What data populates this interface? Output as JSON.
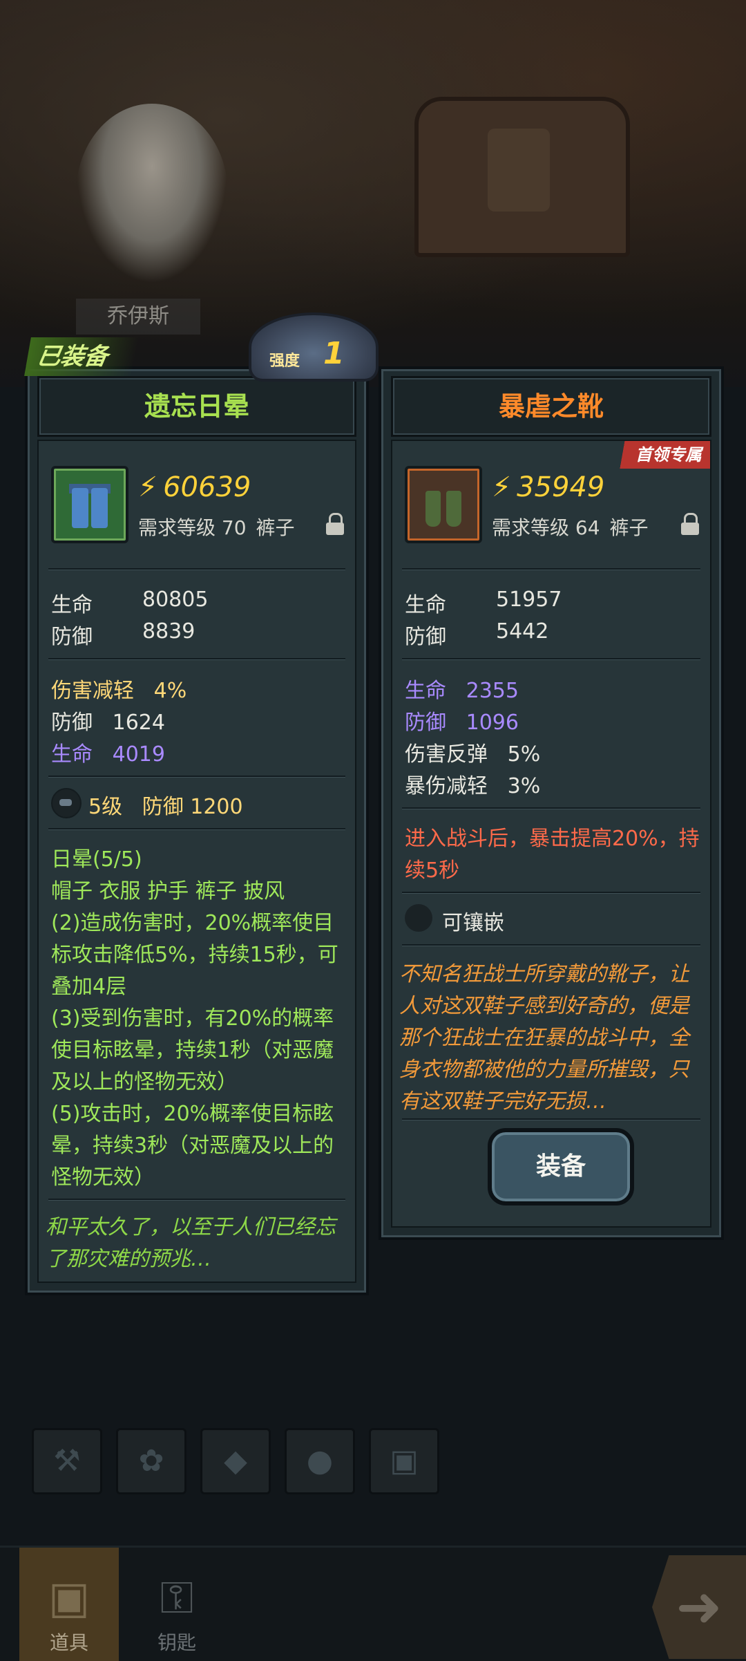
{
  "hero": {
    "name": "乔伊斯"
  },
  "badges": {
    "equipped": "已装备",
    "strength_label": "强度",
    "strength_value": "1"
  },
  "left_item": {
    "name": "遗忘日晕",
    "power": "60639",
    "requirement": "需求等级 70",
    "slot": "裤子",
    "base_stats": [
      {
        "label": "生命",
        "value": "80805"
      },
      {
        "label": "防御",
        "value": "8839"
      }
    ],
    "extra_stats": [
      {
        "label": "伤害减轻",
        "value": "4%"
      },
      {
        "label": "防御",
        "value": "1624"
      },
      {
        "label": "生命",
        "value": "4019"
      }
    ],
    "gem": {
      "level": "5级",
      "stat": "防御 1200"
    },
    "set_lines": [
      "日晕(5/5)",
      "帽子 衣服 护手 裤子 披风",
      "(2)造成伤害时，20%概率使目",
      "标攻击降低5%，持续15秒，可",
      "叠加4层",
      "(3)受到伤害时，有20%的概率",
      "使目标眩晕，持续1秒（对恶魔",
      "及以上的怪物无效）",
      "(5)攻击时，20%概率使目标眩",
      "晕，持续3秒（对恶魔及以上的",
      "怪物无效）"
    ],
    "flavor_lines": [
      "和平太久了，以至于人们已经忘",
      "了那灾难的预兆…"
    ]
  },
  "right_item": {
    "name": "暴虐之靴",
    "tag": "首领专属",
    "power": "35949",
    "requirement": "需求等级 64",
    "slot": "裤子",
    "base_stats": [
      {
        "label": "生命",
        "value": "51957"
      },
      {
        "label": "防御",
        "value": "5442"
      }
    ],
    "extra_stats": [
      {
        "label": "生命",
        "value": "2355"
      },
      {
        "label": "防御",
        "value": "1096"
      },
      {
        "label": "伤害反弹",
        "value": "5%"
      },
      {
        "label": "暴伤减轻",
        "value": "3%"
      }
    ],
    "skill_lines": [
      "进入战斗后，暴击提高20%，持",
      "续5秒"
    ],
    "socket": "可镶嵌",
    "flavor_lines": [
      "不知名狂战士所穿戴的靴子，让",
      "人对这双鞋子感到好奇的，便是",
      "那个狂战士在狂暴的战斗中，全",
      "身衣物都被他的力量所摧毁，只",
      "有这双鞋子完好无损…"
    ],
    "equip_button": "装备"
  },
  "nav": [
    {
      "label": "道具",
      "icon": "chest-icon"
    },
    {
      "label": "钥匙",
      "icon": "key-icon"
    }
  ],
  "filters": [
    "hammer-icon",
    "paw-icon",
    "gem-icon",
    "ore-icon",
    "chest-icon"
  ],
  "colors": {
    "green_title": "#a8e050",
    "orange_title": "#ff8a2a",
    "purple_stat": "#a98aff",
    "gold_stat": "#ffd878"
  }
}
